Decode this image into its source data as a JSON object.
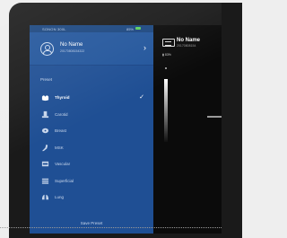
{
  "status_bar": {
    "left": "SONON 300L",
    "right": "85%"
  },
  "profile": {
    "name": "No Name",
    "id": "20170808154322"
  },
  "section_label": "Preset",
  "presets": [
    {
      "label": "Thyroid",
      "icon": "thyroid-icon",
      "selected": true
    },
    {
      "label": "Carotid",
      "icon": "carotid-icon",
      "selected": false
    },
    {
      "label": "Breast",
      "icon": "breast-icon",
      "selected": false
    },
    {
      "label": "MSK",
      "icon": "msk-icon",
      "selected": false
    },
    {
      "label": "Vascular",
      "icon": "vascular-icon",
      "selected": false
    },
    {
      "label": "Superficial",
      "icon": "superficial-icon",
      "selected": false
    },
    {
      "label": "Lung",
      "icon": "lung-icon",
      "selected": false
    }
  ],
  "save_preset_label": "Save Preset",
  "image_panel": {
    "name": "No Name",
    "id": "20170808154",
    "battery_text": "83%"
  },
  "colors": {
    "panel": "#1f4f94",
    "profile": "#23569c",
    "accent_check": "#ffffff",
    "battery": "#5ccf5c"
  }
}
